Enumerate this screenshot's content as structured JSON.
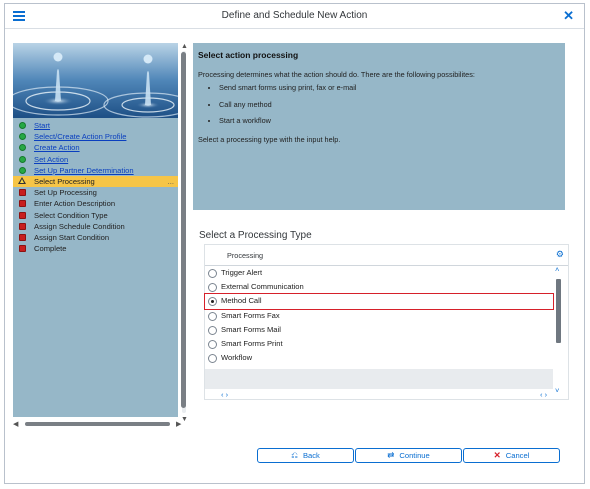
{
  "window": {
    "title": "Define and Schedule New Action"
  },
  "wizard": {
    "steps": [
      {
        "label": "Start",
        "status": "done",
        "link": true
      },
      {
        "label": "Select/Create Action Profile",
        "status": "done",
        "link": true
      },
      {
        "label": "Create Action",
        "status": "done",
        "link": true
      },
      {
        "label": "Set Action",
        "status": "done",
        "link": true
      },
      {
        "label": "Set Up Partner Determination",
        "status": "done",
        "link": true
      },
      {
        "label": "Select Processing",
        "status": "current",
        "link": false,
        "suffix": "..."
      },
      {
        "label": "Set Up Processing",
        "status": "pending",
        "link": false
      },
      {
        "label": "Enter Action Description",
        "status": "pending",
        "link": false
      },
      {
        "label": "Select Condition Type",
        "status": "pending",
        "link": false
      },
      {
        "label": "Assign Schedule Condition",
        "status": "pending",
        "link": false
      },
      {
        "label": "Assign Start Condition",
        "status": "pending",
        "link": false
      },
      {
        "label": "Complete",
        "status": "pending",
        "link": false
      }
    ]
  },
  "info": {
    "heading": "Select action processing",
    "intro": "Processing determines what the action should do. There are the following possibilites:",
    "bullets": [
      "Send smart forms using print, fax or e-mail",
      "Call any method",
      "Start a workflow"
    ],
    "hint": "Select a processing type with the input help."
  },
  "processing": {
    "section_title": "Select a Processing Type",
    "column_header": "Processing",
    "options": [
      {
        "label": "Trigger Alert",
        "selected": false
      },
      {
        "label": "External Communication",
        "selected": false
      },
      {
        "label": "Method Call",
        "selected": true
      },
      {
        "label": "Smart Forms Fax",
        "selected": false
      },
      {
        "label": "Smart Forms Mail",
        "selected": false
      },
      {
        "label": "Smart Forms Print",
        "selected": false
      },
      {
        "label": "Workflow",
        "selected": false
      }
    ]
  },
  "buttons": {
    "back": "Back",
    "continue": "Continue",
    "cancel": "Cancel"
  },
  "colors": {
    "accent": "#0a6ed1",
    "panel": "#96b7c8",
    "current_step": "#f6c547",
    "highlight": "#d6202a"
  }
}
